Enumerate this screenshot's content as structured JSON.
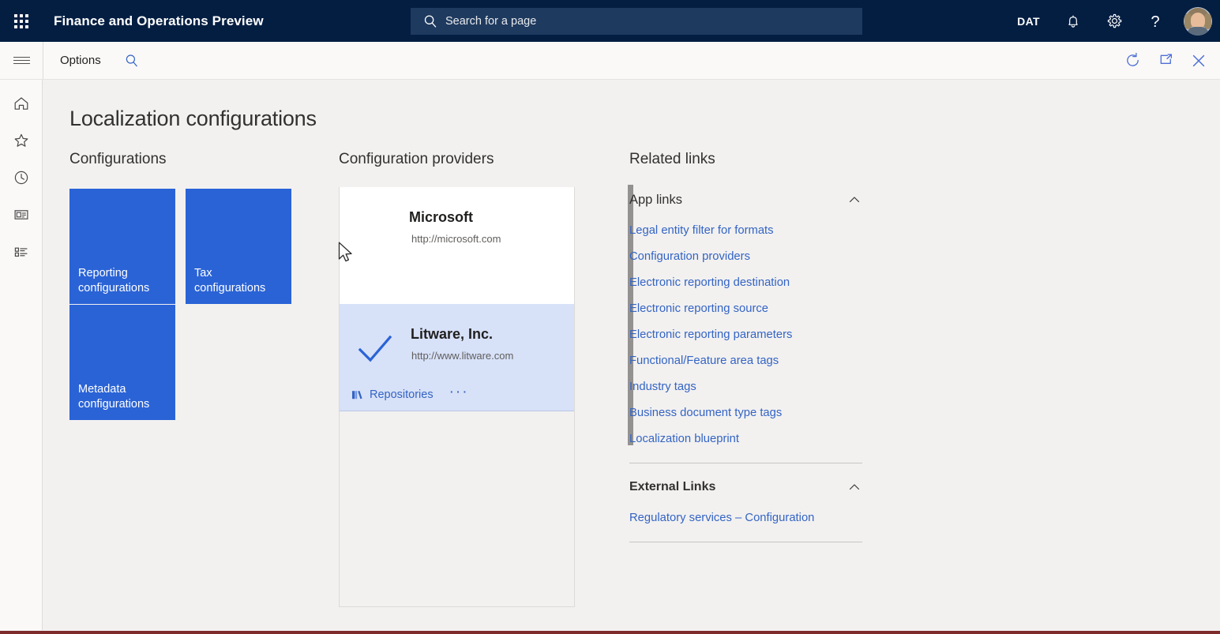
{
  "topbar": {
    "waffle_icon": "app-launcher-icon",
    "app_title": "Finance and Operations Preview",
    "search": {
      "icon": "search-icon",
      "placeholder": "Search for a page",
      "value": ""
    },
    "company": "DAT",
    "notifications_icon": "bell-icon",
    "settings_icon": "gear-icon",
    "help_icon": "question-mark-icon",
    "avatar": "user-avatar"
  },
  "commandbar": {
    "menu_icon": "hamburger-icon",
    "options_label": "Options",
    "search_icon": "search-icon",
    "refresh_icon": "refresh-icon",
    "popout_icon": "open-in-new-window-icon",
    "close_icon": "close-icon"
  },
  "leftrail": {
    "items": [
      {
        "icon": "home-icon",
        "name": "home"
      },
      {
        "icon": "star-icon",
        "name": "favorites"
      },
      {
        "icon": "clock-icon",
        "name": "recent"
      },
      {
        "icon": "workspaces-icon",
        "name": "workspaces"
      },
      {
        "icon": "modules-list-icon",
        "name": "modules"
      }
    ]
  },
  "page": {
    "title": "Localization configurations"
  },
  "configurations": {
    "heading": "Configurations",
    "tiles": [
      {
        "label": "Reporting configurations",
        "color": "#2a63d6"
      },
      {
        "label": "Tax configurations",
        "color": "#2a63d6"
      },
      {
        "label": "Metadata configurations",
        "color": "#2a63d6"
      }
    ]
  },
  "providers": {
    "heading": "Configuration providers",
    "items": [
      {
        "name": "Microsoft",
        "url": "http://microsoft.com",
        "selected": false
      },
      {
        "name": "Litware, Inc.",
        "url": "http://www.litware.com",
        "selected": true,
        "check_icon": "checkmark-icon",
        "repositories_label": "Repositories",
        "repositories_icon": "books-icon",
        "more_label": "···"
      }
    ],
    "scrollbar_color": "#949290"
  },
  "related": {
    "heading": "Related links",
    "groups": [
      {
        "title": "App links",
        "collapse_icon": "chevron-up-icon",
        "links": [
          "Legal entity filter for formats",
          "Configuration providers",
          "Electronic reporting destination",
          "Electronic reporting source",
          "Electronic reporting parameters",
          "Functional/Feature area tags",
          "Industry tags",
          "Business document type tags",
          "Localization blueprint"
        ]
      },
      {
        "title": "External Links",
        "collapse_icon": "chevron-up-icon",
        "links": [
          "Regulatory services – Configuration"
        ]
      }
    ]
  },
  "colors": {
    "navbar": "#041e42",
    "accent_blue": "#2a63d6",
    "link_blue": "#3464c4",
    "selected_card": "#d7e1f8",
    "page_bg": "#f2f1f0"
  },
  "cursor": {
    "icon": "mouse-pointer"
  }
}
